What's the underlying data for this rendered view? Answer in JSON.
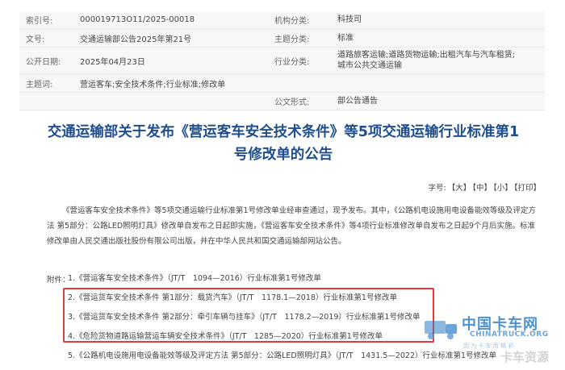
{
  "meta": {
    "index_label": "索引号:",
    "index_value": "000019713O11/2025-00018",
    "org_label": "机构分类:",
    "org_value": "科技司",
    "docno_label": "文号:",
    "docno_value": "交通运输部公告2025年第21号",
    "topic_label": "主题分类:",
    "topic_value": "标准",
    "date_label": "公开日期:",
    "date_value": "2025年04月23日",
    "industry_label": "行业分类:",
    "industry_value_line1": "道路旅客运输;道路货物运输;出租汽车与汽车租赁;",
    "industry_value_line2": "城市公共交通运输",
    "keyword_label": "主题词:",
    "keyword_value": "营运客车;安全技术条件;行业标准;修改单",
    "form_label": "公文形式:",
    "form_value": "部公告通告"
  },
  "title_line1": "交通运输部关于发布《营运客车安全技术条件》等5项交通运输行业标准第1",
  "title_line2": "号修改单的公告",
  "fontsize": {
    "label": "字号:",
    "large": "【大】",
    "medium": "【中】",
    "small": "【小】",
    "print": "【打印】"
  },
  "body_text": "《营运客车安全技术条件》等5项交通运输行业标准第1号修改单业经审查通过，现予发布。其中，《公路机电设施用电设备能效等级及评定方法 第5部分：公路LED照明灯具》修改单自发布之日起即实施，《营运客车安全技术条件》等4项行业标准修改单自发布之日起9个月后实施。标准修改单由人民交通出版社股份有限公司出版，并在中华人民共和国交通运输部网站公告。",
  "attachments": {
    "label": "附件：",
    "items": [
      "1.《营运客车安全技术条件》（JT/T　1094—2016）行业标准第1号修改单",
      "2.《营运货车安全技术条件 第1部分：载货汽车》（JT/T　1178.1—2018）行业标准第1号修改单",
      "3.《营运货车安全技术条件 第2部分：牵引车辆与挂车》（JT/T　1178.2—2019）行业标准第1号修改单",
      "4.《危险货物道路运输营运车辆安全技术条件》（JT/T　1285—2020）行业标准第1号修改单",
      "5.《公路机电设施用电设备能效等级及评定方法 第5部分：公路LED照明灯具》（JT/T　1431.5—2022）行业标准第1号修改单"
    ]
  },
  "watermark": {
    "cn": "中国卡车网",
    "en": "CHINATRUCK.ORG",
    "slogan": "因 为 卡 车 而 精 彩",
    "sub": "卡车资源"
  },
  "colors": {
    "title": "#1f4e8c",
    "highlight_border": "#e03c3c",
    "meta_bg": "#f7f7f7"
  }
}
